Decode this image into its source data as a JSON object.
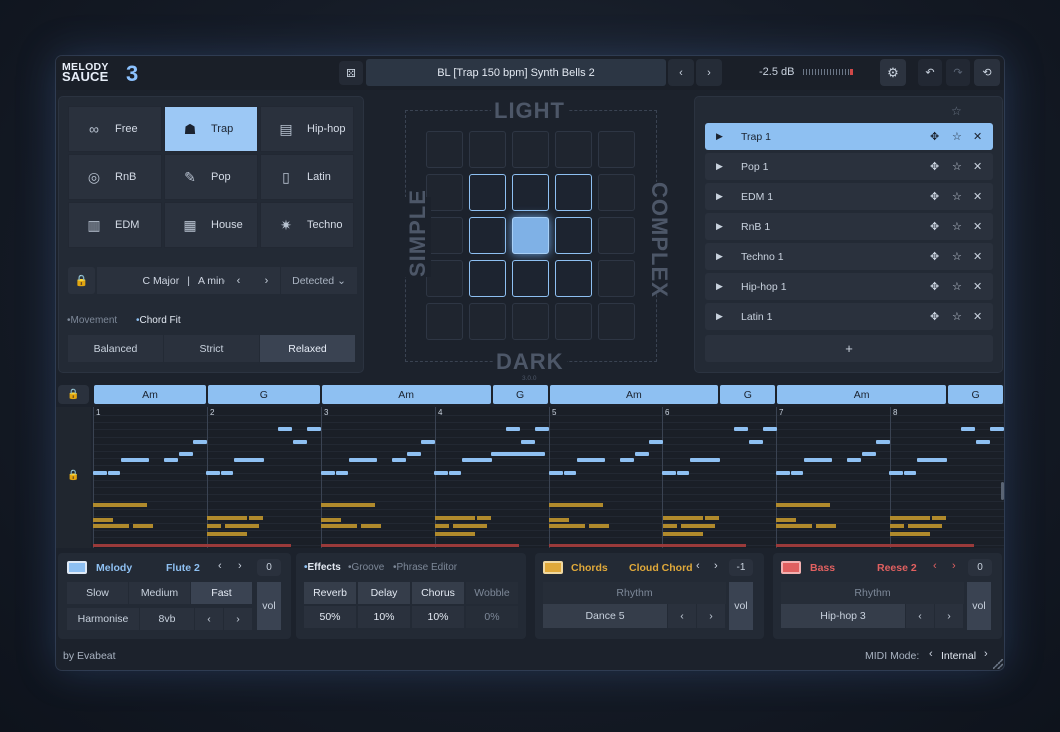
{
  "app": {
    "logo_line1": "MELODY",
    "logo_line2": "SAUCE",
    "logo_number": "3"
  },
  "topbar": {
    "preset_name": "BL  [Trap 150 bpm]  Synth Bells 2",
    "volume": "-2.5 dB"
  },
  "genres": [
    {
      "label": "Free",
      "icon": "infinity-icon"
    },
    {
      "label": "Trap",
      "icon": "hooded-figure-icon"
    },
    {
      "label": "Hip-hop",
      "icon": "boombox-icon"
    },
    {
      "label": "RnB",
      "icon": "vinyl-icon"
    },
    {
      "label": "Pop",
      "icon": "microphone-icon"
    },
    {
      "label": "Latin",
      "icon": "speaker-icon"
    },
    {
      "label": "EDM",
      "icon": "synth-icon"
    },
    {
      "label": "House",
      "icon": "piano-icon"
    },
    {
      "label": "Techno",
      "icon": "atom-icon"
    }
  ],
  "key": {
    "major": "C Major",
    "minor": "A minor",
    "detect": "Detected"
  },
  "mode_tabs": {
    "movement": "Movement",
    "chordfit": "Chord Fit"
  },
  "fit": [
    "Balanced",
    "Strict",
    "Relaxed"
  ],
  "pad": {
    "top": "LIGHT",
    "bottom": "DARK",
    "left": "SIMPLE",
    "right": "COMPLEX",
    "version": "3.0.0"
  },
  "presets": [
    "Trap 1",
    "Pop 1",
    "EDM 1",
    "RnB 1",
    "Techno 1",
    "Hip-hop 1",
    "Latin 1"
  ],
  "add_label": "+",
  "chords": [
    {
      "label": "Am"
    },
    {
      "label": "G"
    },
    {
      "label": "Am"
    },
    {
      "label": "G"
    },
    {
      "label": "Am"
    },
    {
      "label": "G"
    },
    {
      "label": "Am"
    },
    {
      "label": "G"
    }
  ],
  "bars": [
    "1",
    "2",
    "3",
    "4",
    "5",
    "6",
    "7",
    "8"
  ],
  "melody": {
    "title": "Melody",
    "instrument": "Flute 2",
    "value": "0",
    "speeds": [
      "Slow",
      "Medium",
      "Fast"
    ],
    "harmonise": "Harmonise",
    "octave": "8vb",
    "vol": "vol"
  },
  "effects": {
    "tabs": [
      "Effects",
      "Groove",
      "Phrase Editor"
    ],
    "names": [
      "Reverb",
      "Delay",
      "Chorus",
      "Wobble"
    ],
    "values": [
      "50%",
      "10%",
      "10%",
      "0%"
    ]
  },
  "chords_panel": {
    "title": "Chords",
    "instrument": "Cloud Chord",
    "value": "-1",
    "rhythm": "Rhythm",
    "pattern": "Dance 5",
    "vol": "vol"
  },
  "bass": {
    "title": "Bass",
    "instrument": "Reese 2",
    "value": "0",
    "rhythm": "Rhythm",
    "pattern": "Hip-hop 3",
    "vol": "vol"
  },
  "footer": {
    "credit": "by Evabeat",
    "midi_label": "MIDI Mode:",
    "midi_value": "Internal"
  },
  "colors": {
    "accent": "#8ec0f2",
    "melody": "#8ec0f2",
    "chords": "#e0a93a",
    "bass": "#e06060"
  }
}
